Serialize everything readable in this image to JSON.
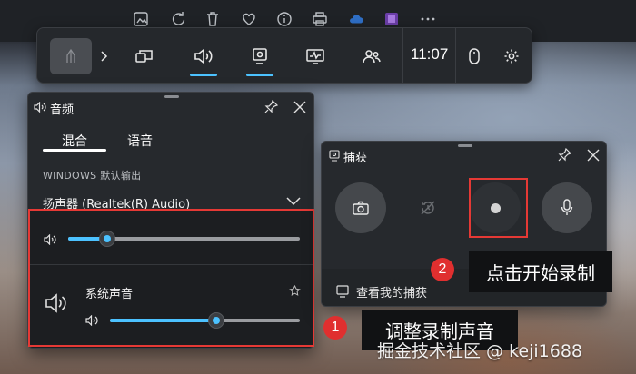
{
  "top_toolbar": {
    "icons": [
      "image-edit-icon",
      "rotate-icon",
      "trash-icon",
      "heart-icon",
      "info-icon",
      "print-icon",
      "cloud-icon",
      "app-icon",
      "more-icon"
    ]
  },
  "gamebar": {
    "time": "11:07",
    "widgets": [
      "capture-widget-icon",
      "audio-widget-icon",
      "capture-icon",
      "performance-icon",
      "social-icon"
    ],
    "active": [
      "audio",
      "capture"
    ]
  },
  "audio_panel": {
    "title": "音频",
    "tabs": [
      {
        "label": "混合",
        "active": true
      },
      {
        "label": "语音",
        "active": false
      }
    ],
    "output_header": "WINDOWS 默认输出",
    "device": "扬声器 (Realtek(R) Audio)",
    "master_volume": 0.17,
    "app_name": "系统声音",
    "app_volume": 0.56
  },
  "capture_panel": {
    "title": "捕获",
    "footer_link": "查看我的捕获"
  },
  "annotations": {
    "badge_1": "1",
    "callout_1": "调整录制声音",
    "badge_2": "2",
    "callout_2": "点击开始录制"
  },
  "watermark": "掘金技术社区 @ keji1688",
  "colors": {
    "accent": "#4cc2ff",
    "highlight": "#e53935",
    "panel": "#26292d"
  }
}
